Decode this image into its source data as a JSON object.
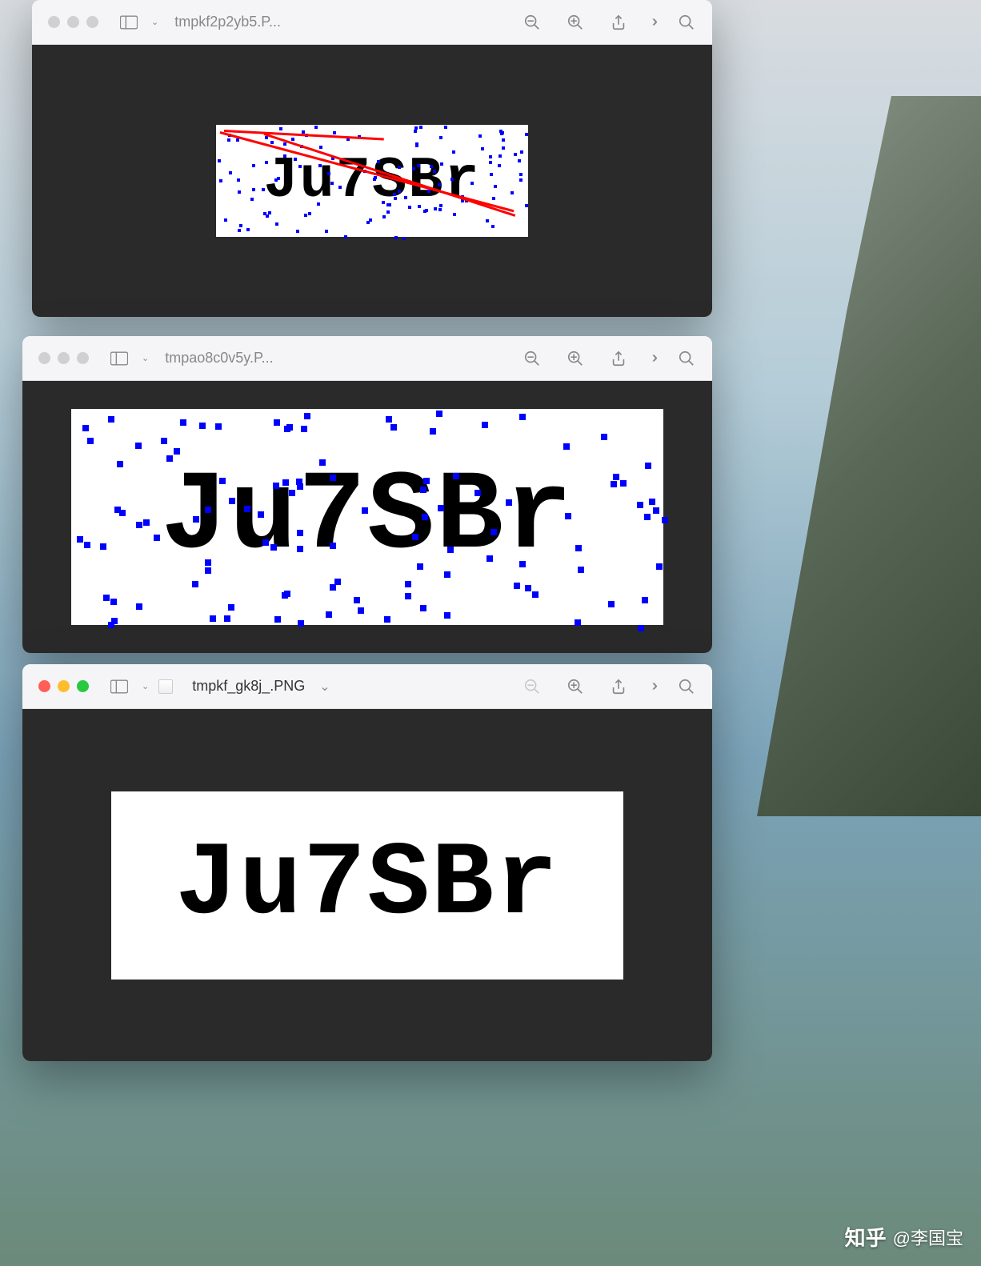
{
  "windows": [
    {
      "title": "tmpkf2p2yb5.P...",
      "active": false,
      "captcha_text": "Ju7SBr",
      "has_red_lines": true,
      "has_blue_dots": true,
      "has_title_chevron": false
    },
    {
      "title": "tmpao8c0v5y.P...",
      "active": false,
      "captcha_text": "Ju7SBr",
      "has_red_lines": false,
      "has_blue_dots": true,
      "has_title_chevron": false
    },
    {
      "title": "tmpkf_gk8j_.PNG",
      "active": true,
      "captcha_text": "Ju7SBr",
      "has_red_lines": false,
      "has_blue_dots": false,
      "has_title_chevron": true
    }
  ],
  "icons": {
    "zoom_out": "zoom-out",
    "zoom_in": "zoom-in",
    "share": "share",
    "more": "more",
    "search": "search"
  },
  "watermark": {
    "logo": "知乎",
    "author": "@李国宝"
  }
}
